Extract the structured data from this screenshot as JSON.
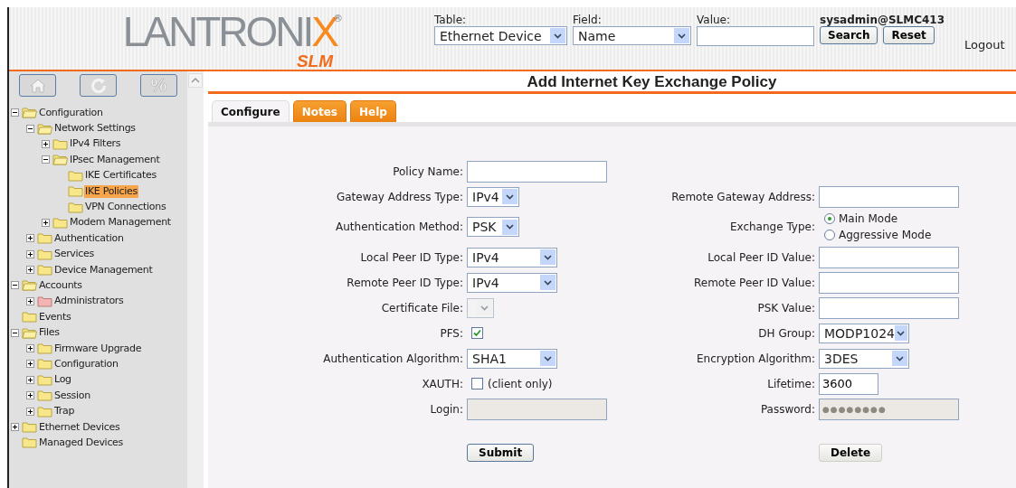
{
  "header": {
    "logo": {
      "name": "LANTRONIX",
      "registered": "®",
      "product": "SLM"
    },
    "search": {
      "table_label": "Table:",
      "table_value": "Ethernet Device",
      "field_label": "Field:",
      "field_value": "Name",
      "value_label": "Value:"
    },
    "user": "sysadmin@SLMC413",
    "buttons": [
      "Search",
      "Reset"
    ],
    "logout": "Logout"
  },
  "sidebar": {
    "toolbar": [
      {
        "kind": "home"
      },
      {
        "kind": "refresh"
      },
      {
        "kind": "glyph",
        "glyph": "%"
      }
    ],
    "tree": [
      {
        "label": "Configuration",
        "kind": "branch",
        "expanded": true,
        "selected": false,
        "children": [
          {
            "label": "Network Settings",
            "kind": "branch",
            "expanded": true,
            "selected": false,
            "children": [
              {
                "label": "IPv4 Filters",
                "kind": "branch",
                "expanded": false,
                "selected": false
              },
              {
                "label": "IPsec Management",
                "kind": "branch",
                "expanded": true,
                "selected": false,
                "children": [
                  {
                    "label": "IKE Certificates",
                    "kind": "leaf",
                    "selected": false
                  },
                  {
                    "label": "IKE Policies",
                    "kind": "leaf",
                    "selected": true
                  },
                  {
                    "label": "VPN Connections",
                    "kind": "leaf",
                    "selected": false
                  }
                ]
              },
              {
                "label": "Modem Management",
                "kind": "branch",
                "expanded": false,
                "selected": false
              }
            ]
          },
          {
            "label": "Authentication",
            "kind": "branch",
            "expanded": false,
            "selected": false
          },
          {
            "label": "Services",
            "kind": "branch",
            "expanded": false,
            "selected": false
          },
          {
            "label": "Device Management",
            "kind": "branch",
            "expanded": false,
            "selected": false
          }
        ]
      },
      {
        "label": "Accounts",
        "kind": "branch",
        "expanded": true,
        "selected": false,
        "children": [
          {
            "label": "Administrators",
            "kind": "branch",
            "expanded": false,
            "selected": false,
            "color": "#f4b4b4"
          }
        ]
      },
      {
        "label": "Events",
        "kind": "leaf",
        "selected": false
      },
      {
        "label": "Files",
        "kind": "branch",
        "expanded": true,
        "selected": false,
        "children": [
          {
            "label": "Firmware Upgrade",
            "kind": "branch",
            "expanded": false,
            "selected": false
          },
          {
            "label": "Configuration",
            "kind": "branch",
            "expanded": false,
            "selected": false
          },
          {
            "label": "Log",
            "kind": "branch",
            "expanded": false,
            "selected": false
          },
          {
            "label": "Session",
            "kind": "branch",
            "expanded": false,
            "selected": false
          },
          {
            "label": "Trap",
            "kind": "branch",
            "expanded": false,
            "selected": false
          }
        ]
      },
      {
        "label": "Ethernet Devices",
        "kind": "branch",
        "expanded": false,
        "selected": false
      },
      {
        "label": "Managed Devices",
        "kind": "leaf",
        "selected": false
      }
    ]
  },
  "page_title": "Add Internet Key Exchange Policy",
  "tabs": [
    {
      "label": "Configure",
      "selected": true
    },
    {
      "label": "Notes",
      "selected": false
    },
    {
      "label": "Help",
      "selected": false
    }
  ],
  "form": {
    "rows": [
      {
        "left": {
          "kind": "text",
          "label": "Policy Name:",
          "disabled": false
        }
      },
      {
        "left": {
          "kind": "select",
          "label": "Gateway Address Type:",
          "value": "IPv4",
          "disabled": false
        },
        "right": {
          "kind": "text",
          "label": "Remote Gateway Address:",
          "disabled": false
        }
      },
      {
        "left": {
          "kind": "select",
          "label": "Authentication Method:",
          "value": "PSK",
          "disabled": false
        },
        "right": {
          "kind": "radio",
          "label": "Exchange Type:",
          "options": [
            {
              "label": "Main Mode",
              "selected": true
            },
            {
              "label": "Aggressive Mode",
              "selected": false
            }
          ]
        }
      },
      {
        "left": {
          "kind": "select",
          "label": "Local Peer ID Type:",
          "value": "IPv4",
          "disabled": false
        },
        "right": {
          "kind": "text",
          "label": "Local Peer ID Value:",
          "disabled": false
        }
      },
      {
        "left": {
          "kind": "select",
          "label": "Remote Peer ID Type:",
          "value": "IPv4",
          "disabled": false
        },
        "right": {
          "kind": "text",
          "label": "Remote Peer ID Value:",
          "disabled": false
        }
      },
      {
        "left": {
          "kind": "select",
          "label": "Certificate File:",
          "disabled": true
        },
        "right": {
          "kind": "text",
          "label": "PSK Value:",
          "disabled": false
        }
      },
      {
        "left": {
          "kind": "checkbox",
          "label": "PFS:",
          "checked": true
        },
        "right": {
          "kind": "select",
          "label": "DH Group:",
          "value": "MODP1024",
          "disabled": false
        }
      },
      {
        "left": {
          "kind": "select",
          "label": "Authentication Algorithm:",
          "value": "SHA1",
          "disabled": false
        },
        "right": {
          "kind": "select",
          "label": "Encryption Algorithm:",
          "value": "3DES",
          "disabled": false
        }
      },
      {
        "left": {
          "kind": "checkbox",
          "label": "XAUTH:",
          "checked": false,
          "note": "(client only)"
        },
        "right": {
          "kind": "text",
          "label": "Lifetime:",
          "value": "3600",
          "disabled": false
        }
      },
      {
        "left": {
          "kind": "text",
          "label": "Login:",
          "disabled": true
        },
        "right": {
          "kind": "text",
          "label": "Password:",
          "value": "●●●●●●●●",
          "disabled": true
        }
      }
    ],
    "buttons": {
      "left": "Submit",
      "right": "Delete"
    }
  }
}
